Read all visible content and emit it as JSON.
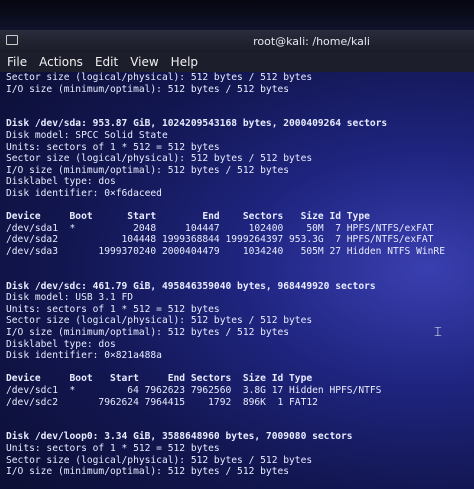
{
  "window": {
    "title": "root@kali: /home/kali"
  },
  "menu": [
    "File",
    "Actions",
    "Edit",
    "View",
    "Help"
  ],
  "terminal_lines": [
    {
      "text": "Sector size (logical/physical): 512 bytes / 512 bytes",
      "bold": false
    },
    {
      "text": "I/O size (minimum/optimal): 512 bytes / 512 bytes",
      "bold": false
    },
    {
      "text": "",
      "bold": false
    },
    {
      "text": "",
      "bold": false
    },
    {
      "text": "Disk /dev/sda: 953.87 GiB, 1024209543168 bytes, 2000409264 sectors",
      "bold": true
    },
    {
      "text": "Disk model: SPCC Solid State",
      "bold": false
    },
    {
      "text": "Units: sectors of 1 * 512 = 512 bytes",
      "bold": false
    },
    {
      "text": "Sector size (logical/physical): 512 bytes / 512 bytes",
      "bold": false
    },
    {
      "text": "I/O size (minimum/optimal): 512 bytes / 512 bytes",
      "bold": false
    },
    {
      "text": "Disklabel type: dos",
      "bold": false
    },
    {
      "text": "Disk identifier: 0×f6daceed",
      "bold": false
    },
    {
      "text": "",
      "bold": false
    },
    {
      "text": "Device     Boot      Start        End    Sectors   Size Id Type",
      "bold": true
    },
    {
      "text": "/dev/sda1  *          2048     104447     102400    50M  7 HPFS/NTFS/exFAT",
      "bold": false
    },
    {
      "text": "/dev/sda2           104448 1999368844 1999264397 953.3G  7 HPFS/NTFS/exFAT",
      "bold": false
    },
    {
      "text": "/dev/sda3       1999370240 2000404479    1034240   505M 27 Hidden NTFS WinRE",
      "bold": false
    },
    {
      "text": "",
      "bold": false
    },
    {
      "text": "",
      "bold": false
    },
    {
      "text": "Disk /dev/sdc: 461.79 GiB, 495846359040 bytes, 968449920 sectors",
      "bold": true
    },
    {
      "text": "Disk model: USB 3.1 FD",
      "bold": false
    },
    {
      "text": "Units: sectors of 1 * 512 = 512 bytes",
      "bold": false
    },
    {
      "text": "Sector size (logical/physical): 512 bytes / 512 bytes",
      "bold": false
    },
    {
      "text": "I/O size (minimum/optimal): 512 bytes / 512 bytes",
      "bold": false
    },
    {
      "text": "Disklabel type: dos",
      "bold": false
    },
    {
      "text": "Disk identifier: 0×821a488a",
      "bold": false
    },
    {
      "text": "",
      "bold": false
    },
    {
      "text": "Device     Boot   Start     End Sectors  Size Id Type",
      "bold": true
    },
    {
      "text": "/dev/sdc1  *         64 7962623 7962560  3.8G 17 Hidden HPFS/NTFS",
      "bold": false
    },
    {
      "text": "/dev/sdc2       7962624 7964415    1792  896K  1 FAT12",
      "bold": false
    },
    {
      "text": "",
      "bold": false
    },
    {
      "text": "",
      "bold": false
    },
    {
      "text": "Disk /dev/loop0: 3.34 GiB, 3588648960 bytes, 7009080 sectors",
      "bold": true
    },
    {
      "text": "Units: sectors of 1 * 512 = 512 bytes",
      "bold": false
    },
    {
      "text": "Sector size (logical/physical): 512 bytes / 512 bytes",
      "bold": false
    },
    {
      "text": "I/O size (minimum/optimal): 512 bytes / 512 bytes",
      "bold": false
    }
  ]
}
